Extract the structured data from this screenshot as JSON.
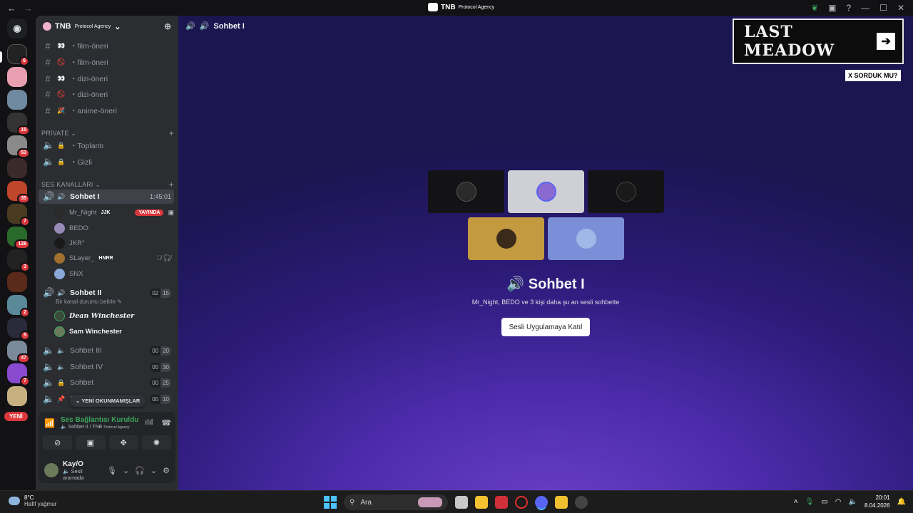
{
  "titlebar": {
    "server": "TNB",
    "server_sub": "Protocol Agency"
  },
  "rail": {
    "badges": [
      "6",
      "15",
      "53",
      "35",
      "7",
      "128",
      "3",
      "2",
      "5",
      "47",
      "7"
    ],
    "new_label": "YENİ"
  },
  "sidebar": {
    "server_name": "TNB",
    "server_sub": "Protocol Agency",
    "channels_top": [
      {
        "emoji": "👀",
        "label": "・film-öneri"
      },
      {
        "emoji": "🚫",
        "label": "・film-öneri"
      },
      {
        "emoji": "👀",
        "label": "・dizi-öneri"
      },
      {
        "emoji": "🚫",
        "label": "・dizi-öneri"
      },
      {
        "emoji": "🎉",
        "label": "・anime-öneri"
      }
    ],
    "private_category": "PRİVATE",
    "private_channels": [
      {
        "emoji": "🔒",
        "label": "・Toplantı"
      },
      {
        "emoji": "🔒",
        "label": "・Gizli"
      }
    ],
    "voice_category": "SES KANALLARI",
    "sohbet1": {
      "label": "Sohbet I",
      "time": "1:45:01"
    },
    "sohbet1_members": [
      {
        "name": "Mr_Night",
        "tag": "JJK",
        "live": "YAYINDA"
      },
      {
        "name": "BEDO"
      },
      {
        "name": "JKR°"
      },
      {
        "name": "SLayer_",
        "tag": "HNRR"
      },
      {
        "name": "SNX"
      }
    ],
    "sohbet2": {
      "label": "Sohbet II",
      "c1": "02",
      "c2": "15",
      "status": "Bir kanal durumu belirle"
    },
    "sohbet2_members": [
      "Dean Winchester",
      "Sam Winchester"
    ],
    "other_voice": [
      {
        "label": "Sohbet III",
        "c1": "00",
        "c2": "20"
      },
      {
        "label": "Sohbet IV",
        "c1": "00",
        "c2": "30"
      },
      {
        "label": "Sohbet",
        "c1": "00",
        "c2": "25"
      },
      {
        "label": "S",
        "c1": "00",
        "c2": "10"
      }
    ],
    "new_unread": "YENİ OKUNMAMIŞLAR"
  },
  "voice_panel": {
    "title": "Ses Bağlantısı Kuruldu",
    "sub": "Sohbet II / TNB",
    "sub_small": "Protocol Agency"
  },
  "user_panel": {
    "name": "Kay/O",
    "status": "Sesli aramada"
  },
  "main": {
    "header": "Sohbet I",
    "title": "Sohbet I",
    "subtitle": "Mr_Night, BEDO ve 3 kişi daha şu an sesli sohbette",
    "join_button": "Sesli Uygulamaya Katıl",
    "overlay_title": "LAST MEADOW",
    "overlay_tag": "X SORDUK MU?"
  },
  "taskbar": {
    "temp": "8°C",
    "weather": "Hafif yağmur",
    "search": "Ara",
    "time": "20:01",
    "date": "8.04.2026"
  }
}
